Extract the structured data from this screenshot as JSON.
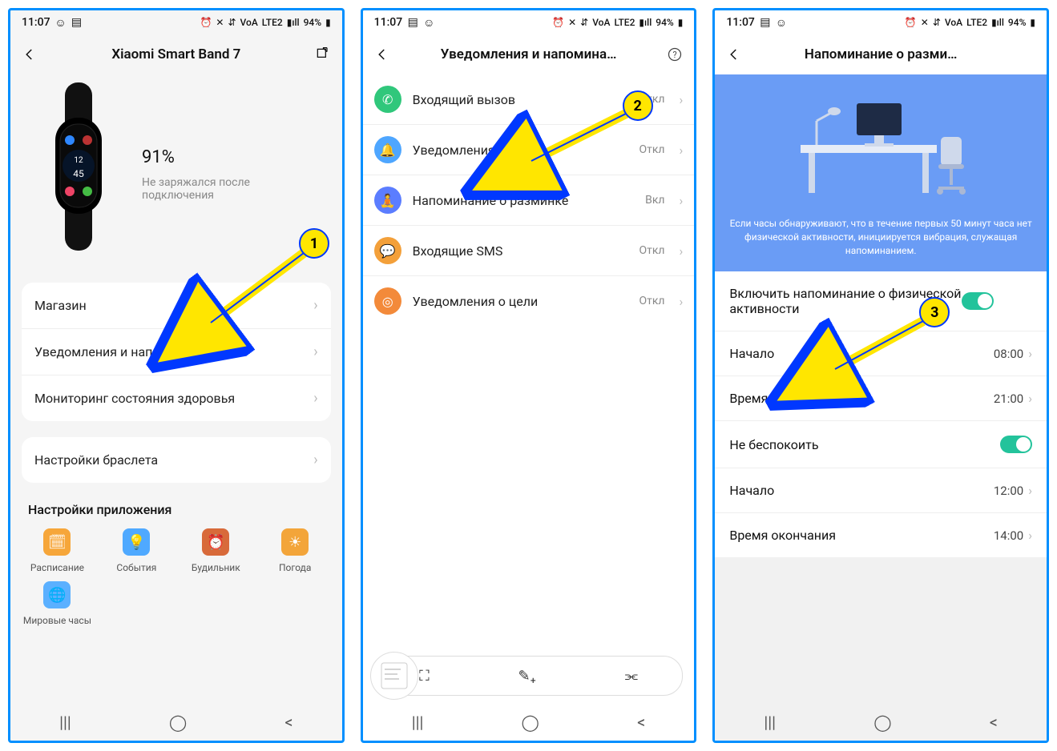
{
  "status": {
    "time": "11:07",
    "battery": "94%",
    "lte": "LTE2",
    "voa": "VoA"
  },
  "phone1": {
    "title": "Xiaomi Smart Band 7",
    "battery_pct": "91",
    "pct_suffix": "%",
    "charge_note": "Не заряжался после подключения",
    "rows": {
      "store": "Магазин",
      "notifications": "Уведомления и напоминания",
      "health": "Мониторинг состояния здоровья"
    },
    "bracelet_settings": "Настройки браслета",
    "app_settings_head": "Настройки приложения",
    "apps": {
      "schedule": "Расписание",
      "events": "События",
      "alarm": "Будильник",
      "weather": "Погода",
      "worldclock": "Мировые часы"
    }
  },
  "phone2": {
    "title": "Уведомления и напомина…",
    "items": [
      {
        "label": "Входящий вызов",
        "status": "Откл"
      },
      {
        "label": "Уведомления",
        "status": "Откл"
      },
      {
        "label": "Напоминание о разминке",
        "status": "Вкл"
      },
      {
        "label": "Входящие SMS",
        "status": "Откл"
      },
      {
        "label": "Уведомления о цели",
        "status": "Откл"
      }
    ]
  },
  "phone3": {
    "title": "Напоминание о разми…",
    "banner_text": "Если часы обнаруживают, что в течение первых 50 минут часа нет физической активности, инициируется вибрация, служащая напоминанием.",
    "toggle1_label": "Включить напоминание о физической активности",
    "start1_label": "Начало",
    "start1_val": "08:00",
    "end1_label": "Время окончания",
    "end1_val": "21:00",
    "dnd_label": "Не беспокоить",
    "start2_label": "Начало",
    "start2_val": "12:00",
    "end2_label": "Время окончания",
    "end2_val": "14:00"
  },
  "callouts": {
    "n1": "1",
    "n2": "2",
    "n3": "3"
  }
}
